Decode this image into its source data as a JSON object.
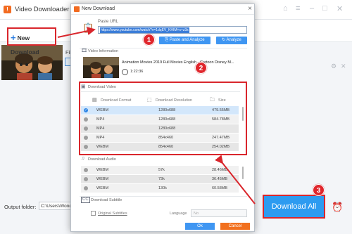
{
  "app": {
    "title": "Video Downloader",
    "logo_glyph": "!",
    "new_download_label": "New Download",
    "file_label": "File",
    "output_folder_label": "Output folder:",
    "output_folder_value": "C:\\Users\\WonderFox\\",
    "download_all_label": "Download All"
  },
  "modal": {
    "title": "New Download",
    "close_glyph": "×",
    "paste_url_label": "Paste URL",
    "url_value": "https://www.youtube.com/watch?v=1dqEV_KHIM+x+z3s",
    "paste_analyze_label": "Paste and Analyze",
    "analyze_label": "Analyze",
    "video_info_label": "Video Information",
    "video_title": "Animation Movies 2019 Full Movies English - Cartoon Disney M...",
    "duration": "1:22:36",
    "download_video_label": "Download Video",
    "video_columns": {
      "format": "Download Format",
      "resolution": "Download Resolution",
      "size": "Size"
    },
    "video_rows": [
      {
        "format": "WEBM",
        "resolution": "1280x688",
        "size": "479.55MB",
        "selected": true
      },
      {
        "format": "MP4",
        "resolution": "1280x688",
        "size": "584.78MB",
        "selected": false
      },
      {
        "format": "MP4",
        "resolution": "1280x688",
        "size": "",
        "selected": false
      },
      {
        "format": "MP4",
        "resolution": "854x460",
        "size": "247.47MB",
        "selected": false
      },
      {
        "format": "WEBM",
        "resolution": "854x460",
        "size": "254.02MB",
        "selected": false
      }
    ],
    "download_audio_label": "Download Audio",
    "audio_rows": [
      {
        "format": "WEBM",
        "bitrate": "57k",
        "size": "28.46MB"
      },
      {
        "format": "WEBM",
        "bitrate": "73k",
        "size": "36.45MB"
      },
      {
        "format": "WEBM",
        "bitrate": "130k",
        "size": "60.58MB"
      }
    ],
    "download_subtitle_label": "Download Subtitle",
    "original_subtitles_label": "Original Subtitles",
    "language_label": "Language",
    "language_value": "No",
    "ok_label": "Ok",
    "cancel_label": "Cancel"
  },
  "badges": [
    "1",
    "2",
    "3"
  ],
  "colors": {
    "accent_blue": "#3f96f2",
    "download_all_blue": "#2d9bf0",
    "cancel_orange": "#f2701e",
    "highlight_red": "#d9262c",
    "selected_row": "#d3e7fb"
  },
  "icons": {
    "paste_url": "clipboard-icon",
    "video_info": "film-icon",
    "clock": "clock-icon",
    "download_video": "video-icon",
    "download_audio": "music-icon",
    "download_subtitle": "cc-icon",
    "alarm": "alarm-clock-icon"
  }
}
